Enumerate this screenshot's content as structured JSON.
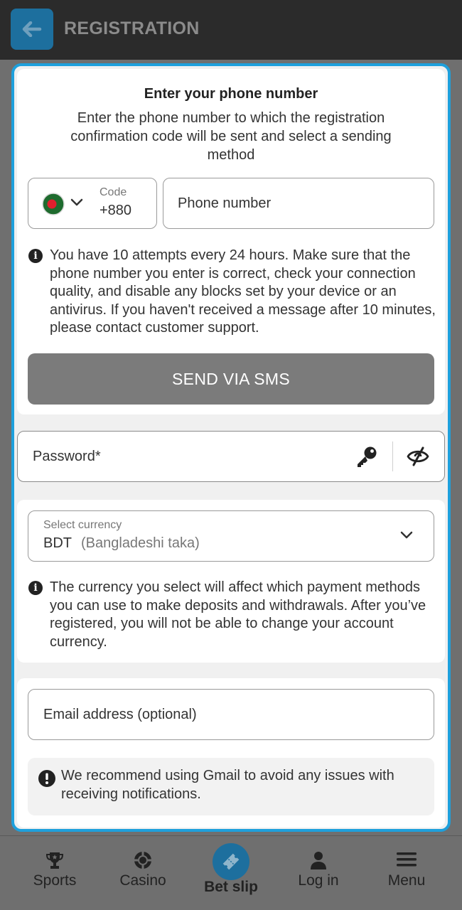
{
  "header": {
    "title": "REGISTRATION",
    "back_icon": "arrow-left-icon"
  },
  "phone_section": {
    "title": "Enter your phone number",
    "description": "Enter the phone number to which the registration confirmation code will be sent and select a sending method",
    "code_label": "Code",
    "code_value": "+880",
    "flag": "bangladesh-flag-icon",
    "phone_placeholder": "Phone number",
    "info": "You have 10 attempts every 24 hours. Make sure that the phone number you enter is correct, check your connection quality, and disable any blocks set by your device or an antivirus. If you haven't received a message after 10 minutes, please contact customer support.",
    "send_button": "SEND VIA SMS"
  },
  "password": {
    "placeholder": "Password*",
    "key_icon": "key-icon",
    "toggle_icon": "eye-hidden-icon"
  },
  "currency": {
    "label": "Select currency",
    "code": "BDT",
    "name": "(Bangladeshi taka)",
    "info": "The currency you select will affect which payment methods you can use to make deposits and withdrawals. After you’ve registered, you will not be able to change your account currency."
  },
  "email": {
    "placeholder": "Email address (optional)",
    "notice": "We recommend using Gmail to avoid any issues with receiving notifications."
  },
  "bottom_nav": {
    "items": [
      {
        "label": "Sports",
        "icon": "trophy-icon"
      },
      {
        "label": "Casino",
        "icon": "casino-chip-icon"
      },
      {
        "label": "Bet slip",
        "icon": "ticket-icon"
      },
      {
        "label": "Log in",
        "icon": "user-icon"
      },
      {
        "label": "Menu",
        "icon": "hamburger-menu-icon"
      }
    ]
  },
  "colors": {
    "accent": "#1ea0dc",
    "header_bg": "#2b2b2b",
    "button_gray": "#7b7b7b"
  }
}
